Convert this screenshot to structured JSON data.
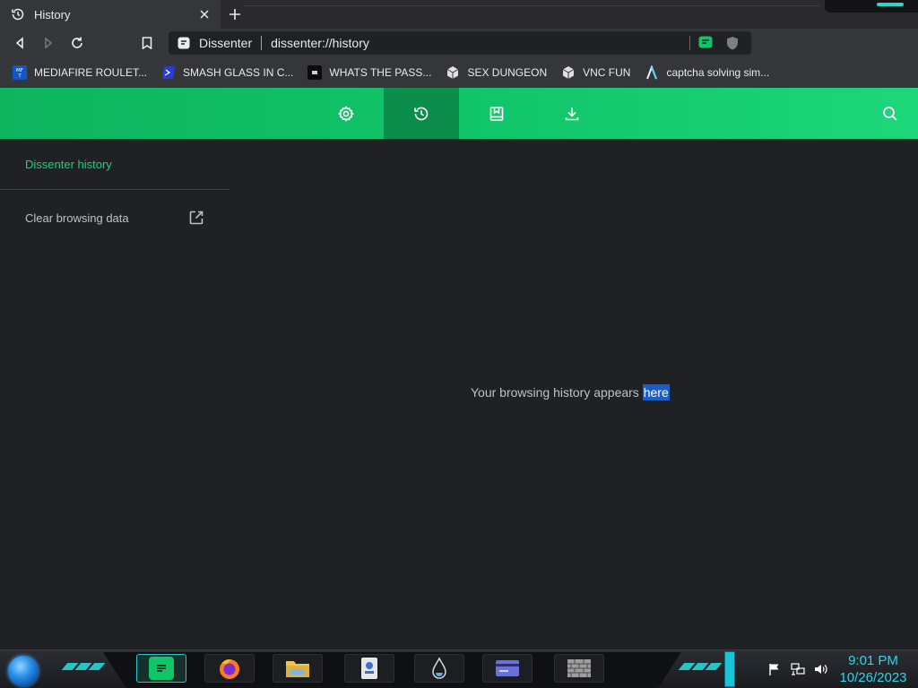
{
  "browser": {
    "tab": {
      "title": "History",
      "icon": "history-icon"
    },
    "omnibox": {
      "site_name": "Dissenter",
      "url": "dissenter://history"
    },
    "bookmarks": [
      {
        "label": "MEDIAFIRE ROULET...",
        "icon": "mediafire-icon"
      },
      {
        "label": "SMASH GLASS IN C...",
        "icon": "powershell-icon"
      },
      {
        "label": "WHATS THE PASS...",
        "icon": "terminal-icon"
      },
      {
        "label": "SEX DUNGEON",
        "icon": "cube-icon"
      },
      {
        "label": "VNC FUN",
        "icon": "cube-icon"
      },
      {
        "label": "captcha solving sim...",
        "icon": "lambda-icon"
      }
    ]
  },
  "app": {
    "header": {
      "buttons": [
        "settings-icon",
        "history-icon",
        "bookmarks-icon",
        "download-icon"
      ],
      "active": "history-icon"
    },
    "sidebar": {
      "title": "Dissenter history",
      "clear_label": "Clear browsing data"
    },
    "main": {
      "empty_text": "Your browsing history appears",
      "empty_highlight": "here"
    }
  },
  "taskbar": {
    "clock_time": "9:01 PM",
    "clock_date": "10/26/2023"
  },
  "colors": {
    "accent_green": "#10c468",
    "active_header": "#0c8d4c",
    "sidebar_title": "#1ed07a",
    "selection": "#1a5fc9",
    "clock": "#2ad6e8"
  }
}
